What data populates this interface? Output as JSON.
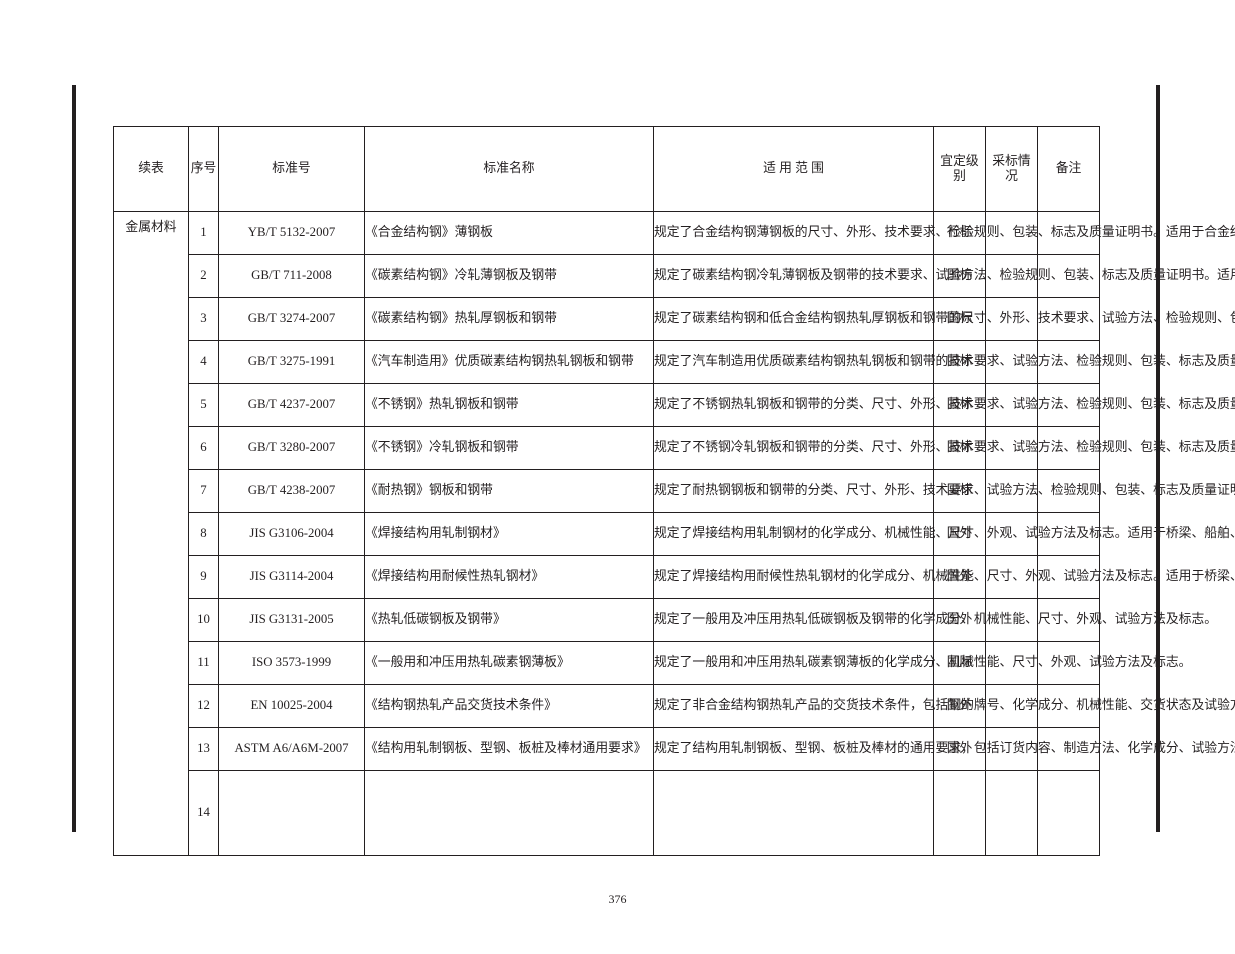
{
  "footer": "376",
  "table": {
    "headers": {
      "c0": "续表",
      "c1": "序号",
      "c2": "标准号",
      "c3": "标准名称",
      "c4": "适 用 范 围",
      "c5": "宜定级别",
      "c6": "采标情况",
      "c7": "备注"
    },
    "group_label": "金属材料",
    "rows": [
      {
        "no": "1",
        "std": "YB/T 5132-2007",
        "name": "《合金结构钢》薄钢板",
        "scope": "规定了合金结构钢薄钢板的尺寸、外形、技术要求、检验规则、包装、标志及质量证明书。适用于合金结构钢热轧薄钢板。",
        "level": "行标",
        "adopt": "",
        "note": ""
      },
      {
        "no": "2",
        "std": "GB/T 711-2008",
        "name": "《碳素结构钢》冷轧薄钢板及钢带",
        "scope": "规定了碳素结构钢冷轧薄钢板及钢带的技术要求、试验方法、检验规则、包装、标志及质量证明书。适用于碳素结构钢冷轧薄钢板及钢带。",
        "level": "国标",
        "adopt": "",
        "note": ""
      },
      {
        "no": "3",
        "std": "GB/T 3274-2007",
        "name": "《碳素结构钢》热轧厚钢板和钢带",
        "scope": "规定了碳素结构钢和低合金结构钢热轧厚钢板和钢带的尺寸、外形、技术要求、试验方法、检验规则、包装、标志及质量证明书。",
        "level": "国标",
        "adopt": "",
        "note": ""
      },
      {
        "no": "4",
        "std": "GB/T 3275-1991",
        "name": "《汽车制造用》优质碳素结构钢热轧钢板和钢带",
        "scope": "规定了汽车制造用优质碳素结构钢热轧钢板和钢带的技术要求、试验方法、检验规则、包装、标志及质量证明书。",
        "level": "国标",
        "adopt": "",
        "note": ""
      },
      {
        "no": "5",
        "std": "GB/T 4237-2007",
        "name": "《不锈钢》热轧钢板和钢带",
        "scope": "规定了不锈钢热轧钢板和钢带的分类、尺寸、外形、技术要求、试验方法、检验规则、包装、标志及质量证明书。",
        "level": "国标",
        "adopt": "",
        "note": ""
      },
      {
        "no": "6",
        "std": "GB/T 3280-2007",
        "name": "《不锈钢》冷轧钢板和钢带",
        "scope": "规定了不锈钢冷轧钢板和钢带的分类、尺寸、外形、技术要求、试验方法、检验规则、包装、标志及质量证明书。",
        "level": "国标",
        "adopt": "",
        "note": ""
      },
      {
        "no": "7",
        "std": "GB/T 4238-2007",
        "name": "《耐热钢》钢板和钢带",
        "scope": "规定了耐热钢钢板和钢带的分类、尺寸、外形、技术要求、试验方法、检验规则、包装、标志及质量证明书。",
        "level": "国标",
        "adopt": "",
        "note": ""
      },
      {
        "no": "8",
        "std": "JIS G3106-2004",
        "name": "《焊接结构用轧制钢材》",
        "scope": "规定了焊接结构用轧制钢材的化学成分、机械性能、尺寸、外观、试验方法及标志。适用于桥梁、船舶、车辆、石油储罐等焊接结构用轧制钢材。",
        "level": "国外",
        "adopt": "",
        "note": ""
      },
      {
        "no": "9",
        "std": "JIS G3114-2004",
        "name": "《焊接结构用耐候性热轧钢材》",
        "scope": "规定了焊接结构用耐候性热轧钢材的化学成分、机械性能、尺寸、外观、试验方法及标志。适用于桥梁、建筑等焊接结构用耐候性热轧钢材。",
        "level": "国外",
        "adopt": "",
        "note": ""
      },
      {
        "no": "10",
        "std": "JIS G3131-2005",
        "name": "《热轧低碳钢板及钢带》",
        "scope": "规定了一般用及冲压用热轧低碳钢板及钢带的化学成分、机械性能、尺寸、外观、试验方法及标志。",
        "level": "国外",
        "adopt": "",
        "note": ""
      },
      {
        "no": "11",
        "std": "ISO 3573-1999",
        "name": "《一般用和冲压用热轧碳素钢薄板》",
        "scope": "规定了一般用和冲压用热轧碳素钢薄板的化学成分、机械性能、尺寸、外观、试验方法及标志。",
        "level": "国际",
        "adopt": "",
        "note": ""
      },
      {
        "no": "12",
        "std": "EN 10025-2004",
        "name": "《结构钢热轧产品交货技术条件》",
        "scope": "规定了非合金结构钢热轧产品的交货技术条件，包括钢的牌号、化学成分、机械性能、交货状态及试验方法。",
        "level": "国外",
        "adopt": "",
        "note": ""
      },
      {
        "no": "13",
        "std": "ASTM A6/A6M-2007",
        "name": "《结构用轧制钢板、型钢、板桩及棒材通用要求》",
        "scope": "规定了结构用轧制钢板、型钢、板桩及棒材的通用要求，包括订货内容、制造方法、化学成分、试验方法、尺寸允许偏差及标志。",
        "level": "国外",
        "adopt": "",
        "note": ""
      },
      {
        "no": "14",
        "std": "",
        "name": "",
        "scope": "",
        "level": "",
        "adopt": "",
        "note": ""
      }
    ]
  }
}
